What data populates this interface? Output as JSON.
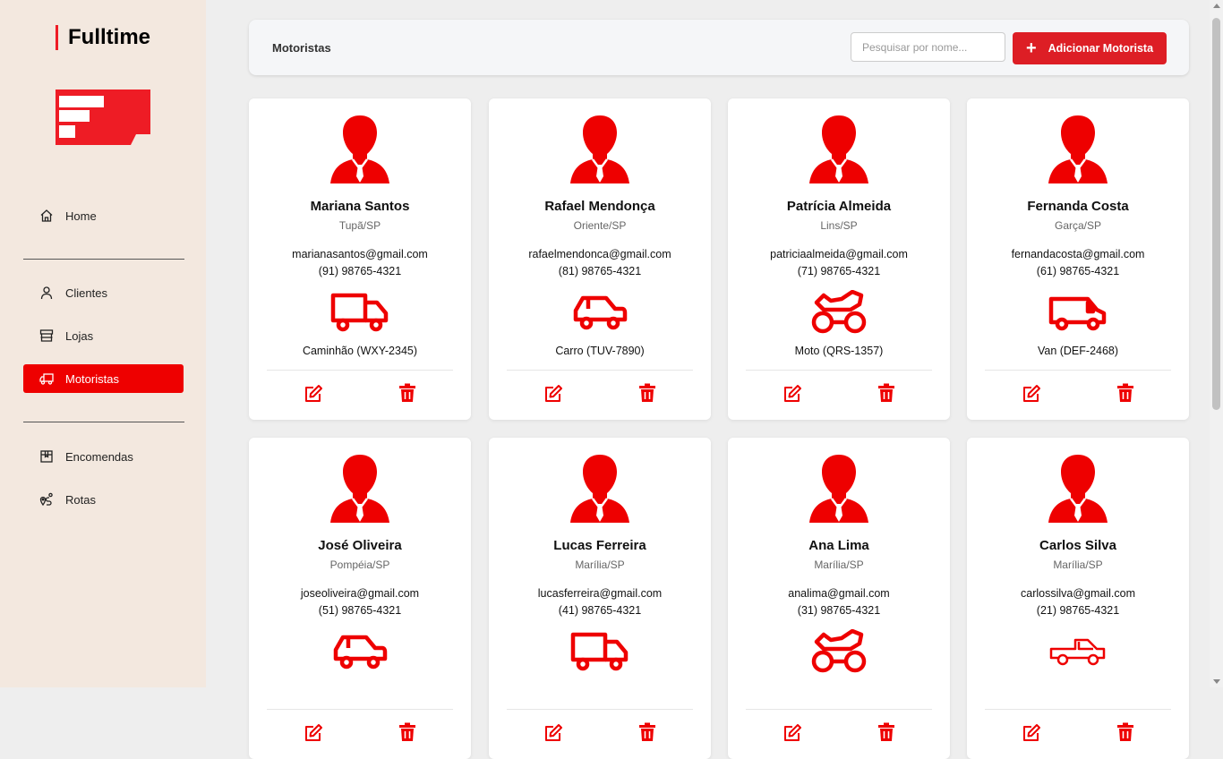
{
  "app": {
    "brand": "Fulltime"
  },
  "sidebar": {
    "items": [
      {
        "label": "Home",
        "icon": "home-icon"
      },
      {
        "label": "Clientes",
        "icon": "user-icon"
      },
      {
        "label": "Lojas",
        "icon": "store-icon"
      },
      {
        "label": "Motoristas",
        "icon": "truck-icon",
        "active": true
      },
      {
        "label": "Encomendas",
        "icon": "package-icon"
      },
      {
        "label": "Rotas",
        "icon": "route-icon"
      }
    ]
  },
  "header": {
    "title": "Motoristas",
    "search_placeholder": "Pesquisar por nome...",
    "add_label": "Adicionar Motorista"
  },
  "colors": {
    "accent": "#ee0000",
    "sidebar_bg": "#f3e8df",
    "button": "#dd1e25"
  },
  "drivers": [
    {
      "name": "Mariana Santos",
      "city": "Tupã/SP",
      "email": "marianasantos@gmail.com",
      "phone": "(91) 98765-4321",
      "vehicle": "Caminhão (WXY-2345)",
      "vehicle_icon": "truck-icon"
    },
    {
      "name": "Rafael Mendonça",
      "city": "Oriente/SP",
      "email": "rafaelmendonca@gmail.com",
      "phone": "(81) 98765-4321",
      "vehicle": "Carro (TUV-7890)",
      "vehicle_icon": "car-icon"
    },
    {
      "name": "Patrícia Almeida",
      "city": "Lins/SP",
      "email": "patriciaalmeida@gmail.com",
      "phone": "(71) 98765-4321",
      "vehicle": "Moto (QRS-1357)",
      "vehicle_icon": "motorcycle-icon"
    },
    {
      "name": "Fernanda Costa",
      "city": "Garça/SP",
      "email": "fernandacosta@gmail.com",
      "phone": "(61) 98765-4321",
      "vehicle": "Van (DEF-2468)",
      "vehicle_icon": "van-icon"
    },
    {
      "name": "José Oliveira",
      "city": "Pompéia/SP",
      "email": "joseoliveira@gmail.com",
      "phone": "(51) 98765-4321",
      "vehicle": "",
      "vehicle_icon": "car-icon"
    },
    {
      "name": "Lucas Ferreira",
      "city": "Marília/SP",
      "email": "lucasferreira@gmail.com",
      "phone": "(41) 98765-4321",
      "vehicle": "",
      "vehicle_icon": "truck-icon"
    },
    {
      "name": "Ana Lima",
      "city": "Marília/SP",
      "email": "analima@gmail.com",
      "phone": "(31) 98765-4321",
      "vehicle": "",
      "vehicle_icon": "motorcycle-icon"
    },
    {
      "name": "Carlos Silva",
      "city": "Marília/SP",
      "email": "carlossilva@gmail.com",
      "phone": "(21) 98765-4321",
      "vehicle": "",
      "vehicle_icon": "pickup-icon"
    }
  ]
}
